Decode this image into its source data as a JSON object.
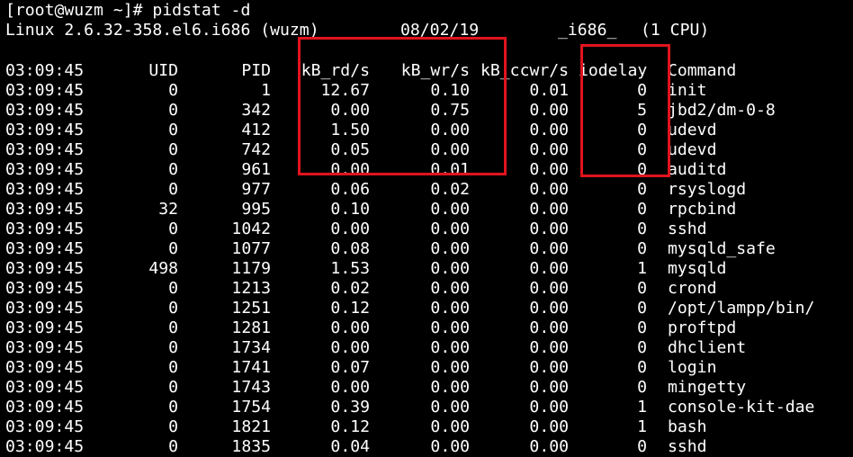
{
  "terminal": {
    "prompt": "[root@wuzm ~]# pidstat -d",
    "sysinfo": {
      "kernel": "Linux 2.6.32-358.el6.i686 (wuzm)",
      "date": "08/02/19",
      "arch": "_i686_",
      "cpus": "(1 CPU)"
    },
    "columns": [
      "03:09:45",
      "UID",
      "PID",
      "kB_rd/s",
      "kB_wr/s",
      "kB_ccwr/s",
      "iodelay",
      "Command"
    ],
    "rows": [
      [
        "03:09:45",
        "0",
        "1",
        "12.67",
        "0.10",
        "0.01",
        "0",
        "init"
      ],
      [
        "03:09:45",
        "0",
        "342",
        "0.00",
        "0.75",
        "0.00",
        "5",
        "jbd2/dm-0-8"
      ],
      [
        "03:09:45",
        "0",
        "412",
        "1.50",
        "0.00",
        "0.00",
        "0",
        "udevd"
      ],
      [
        "03:09:45",
        "0",
        "742",
        "0.05",
        "0.00",
        "0.00",
        "0",
        "udevd"
      ],
      [
        "03:09:45",
        "0",
        "961",
        "0.00",
        "0.01",
        "0.00",
        "0",
        "auditd"
      ],
      [
        "03:09:45",
        "0",
        "977",
        "0.06",
        "0.02",
        "0.00",
        "0",
        "rsyslogd"
      ],
      [
        "03:09:45",
        "32",
        "995",
        "0.10",
        "0.00",
        "0.00",
        "0",
        "rpcbind"
      ],
      [
        "03:09:45",
        "0",
        "1042",
        "0.00",
        "0.00",
        "0.00",
        "0",
        "sshd"
      ],
      [
        "03:09:45",
        "0",
        "1077",
        "0.08",
        "0.00",
        "0.00",
        "0",
        "mysqld_safe"
      ],
      [
        "03:09:45",
        "498",
        "1179",
        "1.53",
        "0.00",
        "0.00",
        "1",
        "mysqld"
      ],
      [
        "03:09:45",
        "0",
        "1213",
        "0.02",
        "0.00",
        "0.00",
        "0",
        "crond"
      ],
      [
        "03:09:45",
        "0",
        "1251",
        "0.12",
        "0.00",
        "0.00",
        "0",
        "/opt/lampp/bin/"
      ],
      [
        "03:09:45",
        "0",
        "1281",
        "0.00",
        "0.00",
        "0.00",
        "0",
        "proftpd"
      ],
      [
        "03:09:45",
        "0",
        "1734",
        "0.00",
        "0.00",
        "0.00",
        "0",
        "dhclient"
      ],
      [
        "03:09:45",
        "0",
        "1741",
        "0.07",
        "0.00",
        "0.00",
        "0",
        "login"
      ],
      [
        "03:09:45",
        "0",
        "1743",
        "0.00",
        "0.00",
        "0.00",
        "0",
        "mingetty"
      ],
      [
        "03:09:45",
        "0",
        "1754",
        "0.39",
        "0.00",
        "0.00",
        "1",
        "console-kit-dae"
      ],
      [
        "03:09:45",
        "0",
        "1821",
        "0.12",
        "0.00",
        "0.00",
        "1",
        "bash"
      ],
      [
        "03:09:45",
        "0",
        "1835",
        "0.04",
        "0.00",
        "0.00",
        "0",
        "sshd"
      ]
    ]
  },
  "colors": {
    "background": "#000000",
    "text": "#ffffff",
    "highlight": "#e0141e"
  }
}
